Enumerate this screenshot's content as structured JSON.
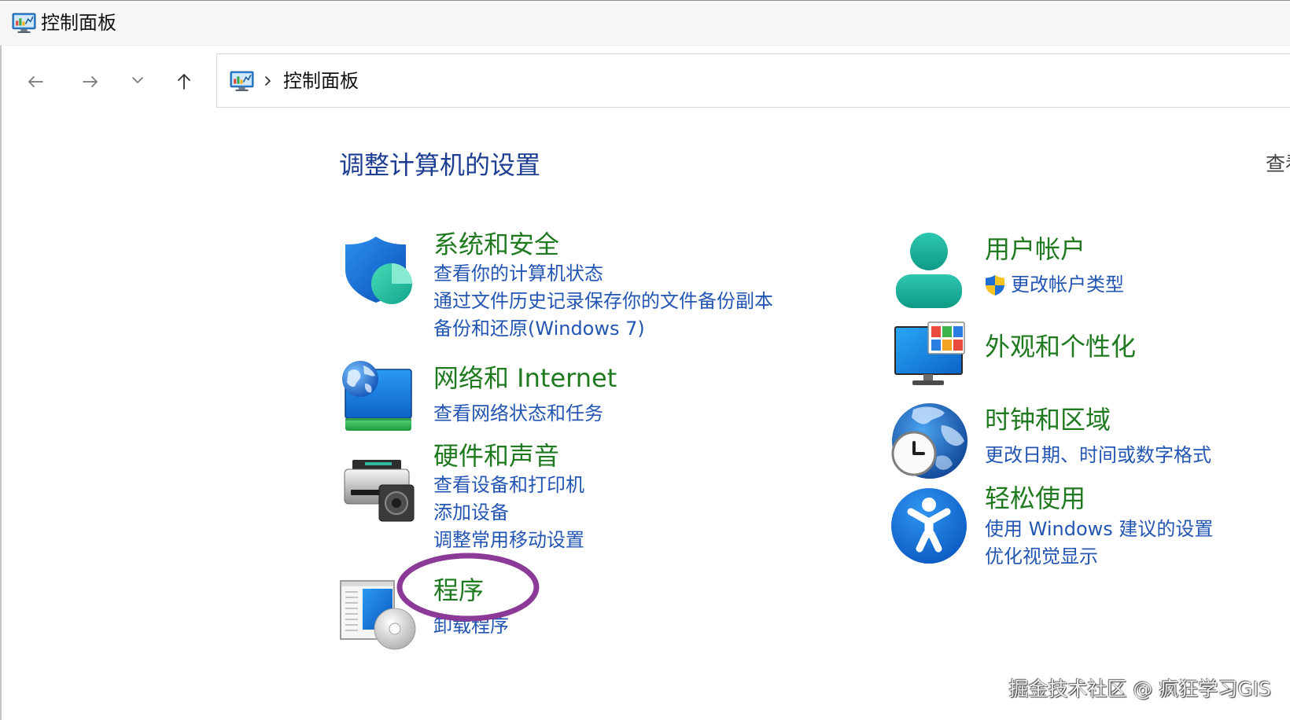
{
  "window": {
    "title": "控制面板",
    "app_icon": "control-panel-icon"
  },
  "nav": {
    "back_icon": "arrow-left-icon",
    "forward_icon": "arrow-right-icon",
    "recent_icon": "chevron-down-icon",
    "up_icon": "arrow-up-icon"
  },
  "address": {
    "location_icon": "control-panel-icon",
    "separator_icon": "chevron-right-icon",
    "path": "控制面板"
  },
  "main": {
    "heading": "调整计算机的设置",
    "view_by_label": "查看",
    "left_categories": [
      {
        "title": "系统和安全",
        "icon": "shield-icon",
        "links": [
          "查看你的计算机状态",
          "通过文件历史记录保存你的文件备份副本",
          "备份和还原(Windows 7)"
        ]
      },
      {
        "title": "网络和 Internet",
        "icon": "network-icon",
        "links": [
          "查看网络状态和任务"
        ]
      },
      {
        "title": "硬件和声音",
        "icon": "printer-speaker-icon",
        "links": [
          "查看设备和打印机",
          "添加设备",
          "调整常用移动设置"
        ]
      },
      {
        "title": "程序",
        "icon": "programs-icon",
        "links": [
          "卸载程序"
        ]
      }
    ],
    "right_categories": [
      {
        "title": "用户帐户",
        "icon": "user-icon",
        "link_badge_icon": "uac-shield-icon",
        "links": [
          "更改帐户类型"
        ]
      },
      {
        "title": "外观和个性化",
        "icon": "appearance-icon",
        "links": []
      },
      {
        "title": "时钟和区域",
        "icon": "clock-globe-icon",
        "links": [
          "更改日期、时间或数字格式"
        ]
      },
      {
        "title": "轻松使用",
        "icon": "accessibility-icon",
        "links": [
          "使用 Windows 建议的设置",
          "优化视觉显示"
        ]
      }
    ]
  },
  "watermark": "掘金技术社区 @ 疯狂学习GIS",
  "colors": {
    "heading": "#1c3d91",
    "category_title": "#1f7a1f",
    "link": "#2356b3",
    "annotation": "#8c3a97"
  }
}
